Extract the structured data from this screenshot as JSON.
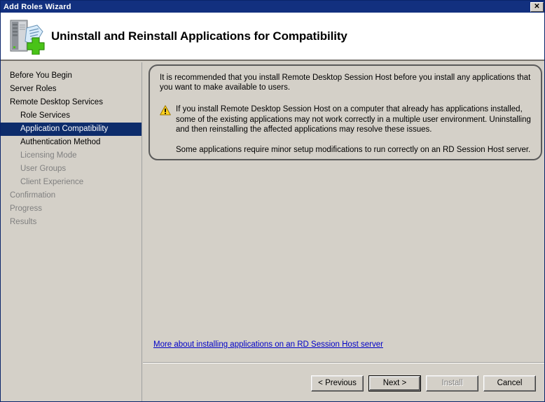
{
  "window": {
    "title": "Add Roles Wizard",
    "close_label": "✕"
  },
  "header": {
    "title": "Uninstall and Reinstall Applications for Compatibility",
    "icon": "server-add-icon"
  },
  "sidebar": {
    "items": [
      {
        "label": "Before You Begin",
        "level": 0,
        "state": "normal"
      },
      {
        "label": "Server Roles",
        "level": 0,
        "state": "normal"
      },
      {
        "label": "Remote Desktop Services",
        "level": 0,
        "state": "normal"
      },
      {
        "label": "Role Services",
        "level": 1,
        "state": "normal"
      },
      {
        "label": "Application Compatibility",
        "level": 1,
        "state": "selected"
      },
      {
        "label": "Authentication Method",
        "level": 1,
        "state": "normal"
      },
      {
        "label": "Licensing Mode",
        "level": 1,
        "state": "disabled"
      },
      {
        "label": "User Groups",
        "level": 1,
        "state": "disabled"
      },
      {
        "label": "Client Experience",
        "level": 1,
        "state": "disabled"
      },
      {
        "label": "Confirmation",
        "level": 0,
        "state": "disabled"
      },
      {
        "label": "Progress",
        "level": 0,
        "state": "disabled"
      },
      {
        "label": "Results",
        "level": 0,
        "state": "disabled"
      }
    ]
  },
  "content": {
    "intro": "It is recommended that you install Remote Desktop Session Host before you install any applications that you want to make available to users.",
    "warning_icon": "warning-triangle-icon",
    "warning": "If you install Remote Desktop Session Host on a computer that already has applications installed, some of the existing applications may not work correctly in a multiple user environment. Uninstalling and then reinstalling the affected applications may resolve these issues.",
    "note": "Some applications require minor setup modifications to run correctly on an RD Session Host server.",
    "help_link": "More about installing applications on an RD Session Host server"
  },
  "buttons": {
    "previous": "< Previous",
    "next": "Next >",
    "install": "Install",
    "cancel": "Cancel"
  },
  "colors": {
    "titlebar": "#12307f",
    "selection": "#0d2c6b",
    "face": "#d4d0c8",
    "link": "#0000c8",
    "warning": "#ffcc00",
    "disabled_text": "#808080"
  }
}
